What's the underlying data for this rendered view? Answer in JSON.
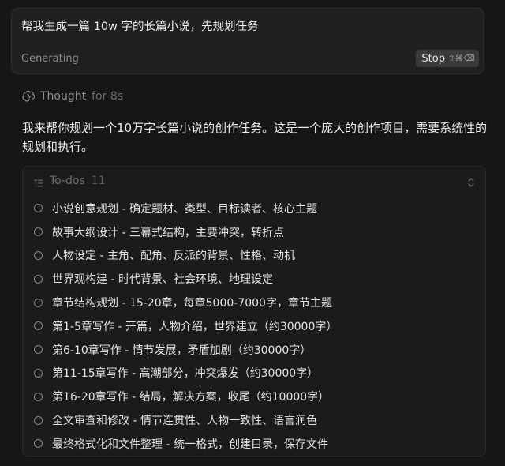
{
  "prompt": {
    "text": "帮我生成一篇 10w 字的长篇小说，先规划任务",
    "status": "Generating",
    "stop_label": "Stop",
    "stop_shortcut": "⇧⌘⌫"
  },
  "thought": {
    "label": "Thought",
    "duration": "for 8s",
    "icon": "brain-icon"
  },
  "assistant": {
    "message": "我来帮你规划一个10万字长篇小说的创作任务。这是一个庞大的创作项目，需要系统性的规划和执行。"
  },
  "todos": {
    "title": "To-dos",
    "count": "11",
    "items": [
      "小说创意规划 - 确定题材、类型、目标读者、核心主题",
      "故事大纲设计 - 三幕式结构，主要冲突，转折点",
      "人物设定 - 主角、配角、反派的背景、性格、动机",
      "世界观构建 - 时代背景、社会环境、地理设定",
      "章节结构规划 - 15-20章，每章5000-7000字，章节主题",
      "第1-5章写作 - 开篇，人物介绍，世界建立（约30000字）",
      "第6-10章写作 - 情节发展，矛盾加剧（约30000字）",
      "第11-15章写作 - 高潮部分，冲突爆发（约30000字）",
      "第16-20章写作 - 结局，解决方案，收尾（约10000字）",
      "全文审查和修改 - 情节连贯性、人物一致性、语言润色",
      "最终格式化和文件整理 - 统一格式，创建目录，保存文件"
    ]
  },
  "colors": {
    "background": "#161616",
    "card": "#202020",
    "stop_button": "#3a3a3a",
    "muted_text": "#8c8c8c"
  }
}
